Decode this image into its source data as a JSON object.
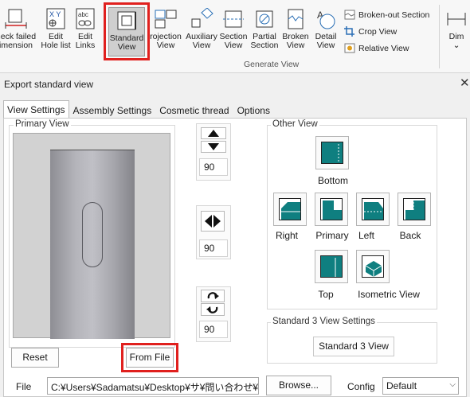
{
  "ribbon": {
    "buttons": [
      {
        "label1": "heck failed",
        "label2": "imension"
      },
      {
        "label1": "Edit",
        "label2": "Hole list"
      },
      {
        "label1": "Edit",
        "label2": "Links"
      },
      {
        "label1": "Standard",
        "label2": "View"
      },
      {
        "label1": "rojection",
        "label2": "View"
      },
      {
        "label1": "Auxiliary",
        "label2": "View"
      },
      {
        "label1": "Section",
        "label2": "View"
      },
      {
        "label1": "Partial",
        "label2": "Section"
      },
      {
        "label1": "Broken",
        "label2": "View"
      },
      {
        "label1": "Detail",
        "label2": "View"
      },
      {
        "label1": "Dim",
        "label2": ""
      }
    ],
    "small_items": [
      "Broken-out Section",
      "Crop View",
      "Relative View"
    ],
    "group_label": "Generate View",
    "expand_glyph": "⌄",
    "icon_labels": {
      "xy": "X Y",
      "abc": "abc",
      "detail": "A"
    }
  },
  "dialog": {
    "title": "Export standard view",
    "close_glyph": "✕",
    "tabs": [
      "View Settings",
      "Assembly Settings",
      "Cosmetic thread",
      "Options"
    ],
    "primary_view_label": "Primary View",
    "rotation": {
      "vertical": "90",
      "horizontal": "90",
      "roll": "90"
    },
    "reset_label": "Reset",
    "from_file_label": "From File",
    "other_view_label": "Other View",
    "views": [
      "Bottom",
      "Right",
      "Primary",
      "Left",
      "Back",
      "Top",
      "Isometric View"
    ],
    "std3_group_label": "Standard 3 View Settings",
    "std3_button": "Standard 3 View",
    "file_label": "File",
    "file_path": "C:¥Users¥Sadamatsu¥Desktop¥サ¥問い合わせ¥052",
    "browse_label": "Browse...",
    "config_label": "Config",
    "config_value": "Default"
  },
  "colors": {
    "accent_teal": "#0f7f80",
    "highlight_red": "#e0201e"
  }
}
